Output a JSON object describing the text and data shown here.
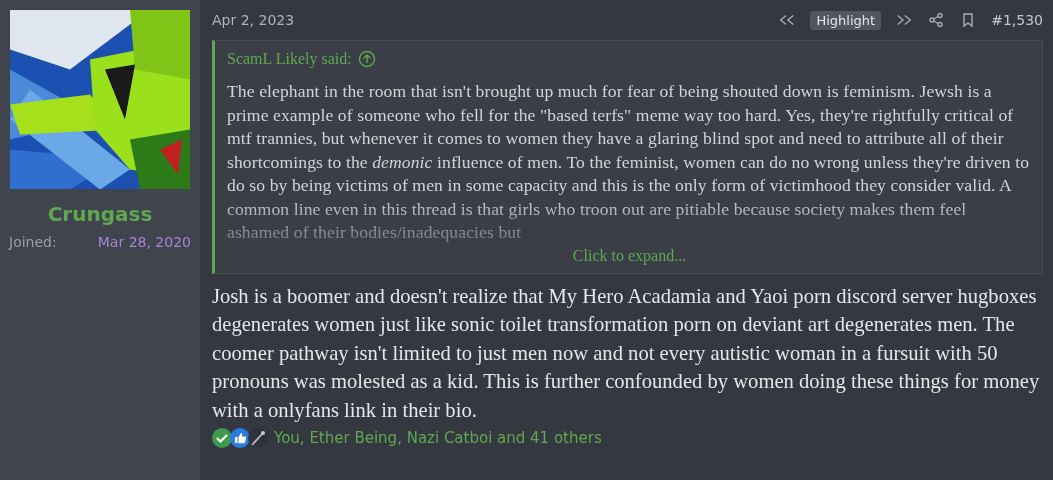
{
  "author": {
    "name": "Crungass",
    "joined_label": "Joined:",
    "joined_date": "Mar 28, 2020"
  },
  "post": {
    "date": "Apr 2, 2023",
    "highlight_label": "Highlight",
    "number": "#1,530",
    "quote": {
      "author": "ScamL Likely said:",
      "text": "The elephant in the room that isn't brought up much for fear of being shouted down is feminism. Jewsh is a prime example of someone who fell for the \"based terfs\" meme way too hard. Yes, they're rightfully critical of mtf trannies, but whenever it comes to women they have a glaring blind spot and need to attribute all of their shortcomings to the *demonic* influence of men. To the feminist, women can do no wrong unless they're driven to do so by being victims of men in some capacity and this is the only form of victimhood they consider valid. A common line even in this thread is that girls who troon out are pitiable because society makes them feel ashamed of their bodies/inadequacies but",
      "expand_label": "Click to expand..."
    },
    "body": "Josh is a boomer and doesn't realize that My Hero Acadamia and Yaoi porn discord server hugboxes degenerates women just like sonic toilet transformation porn on deviant art degenerates men. The coomer pathway isn't limited to just men now and not every autistic woman in a fursuit with 50 pronouns was molested as a kid. This is further confounded by women doing these things for money with a onlyfans link in their bio.",
    "reactions": {
      "icons": [
        {
          "kind": "check"
        },
        {
          "kind": "like"
        },
        {
          "kind": "wand"
        }
      ],
      "text": "You, Ether Being, Nazi Catboi and 41 others"
    }
  }
}
